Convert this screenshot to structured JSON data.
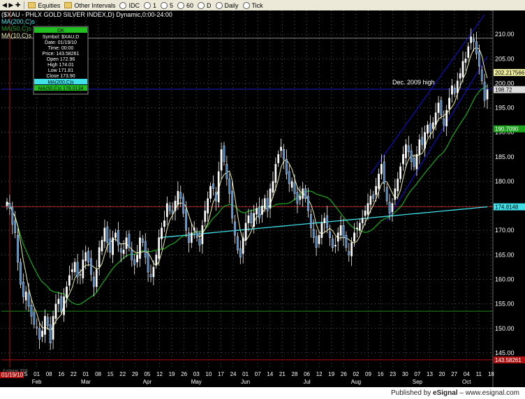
{
  "toolbar": {
    "items": [
      "Equities",
      "Other Intervals",
      "IDC",
      "1",
      "5",
      "60",
      "D",
      "Daily",
      "Tick"
    ]
  },
  "chart_data": {
    "type": "candlestick",
    "title": "($XAU - PHLX GOLD SILVER INDEX,D) Dynamic,0:00-24:00",
    "legend": {
      "ma_cyan": "MA(200,C)s",
      "ma_green": "MA(50,C)s",
      "ma_yellow": "MA(10,C)s"
    },
    "cursor_box": {
      "status": "OK",
      "rows": [
        "Symbol: $XAU,D",
        "Date: 01/19/10",
        "Time: 00:00",
        "Price: 143.58261",
        "Open 172.96",
        "High 174.01",
        "Low 171.81",
        "Close 173.90"
      ],
      "ma_row_cyan": "MA(200,C)s",
      "ma_row_green": "MA(50,C)s 178.0134"
    },
    "ylim": [
      142,
      214
    ],
    "y_ticks": [
      "145.00",
      "150.00",
      "155.00",
      "160.00",
      "165.00",
      "170.00",
      "175.00",
      "180.00",
      "185.00",
      "190.00",
      "195.00",
      "200.00",
      "205.00",
      "210.00"
    ],
    "x_ticks": [
      "25",
      "01",
      "08",
      "16",
      "22",
      "01",
      "08",
      "15",
      "22",
      "29",
      "05",
      "12",
      "19",
      "26",
      "03",
      "10",
      "17",
      "24",
      "01",
      "07",
      "14",
      "21",
      "28",
      "06",
      "12",
      "19",
      "26",
      "02",
      "09",
      "16",
      "23",
      "30",
      "07",
      "13",
      "20",
      "27",
      "04",
      "11",
      "18"
    ],
    "months": [
      "Feb",
      "Mar",
      "Apr",
      "May",
      "Jun",
      "Jul",
      "Aug",
      "Sep",
      "Oct"
    ],
    "cursor_date": "01/19/10",
    "annotation": "Dec. 2009 high",
    "price_tags": {
      "ma_yellow": "202.217566",
      "last": "198.72",
      "ma_green": "190.7090",
      "ma_cyan": "174.8148",
      "cursor": "143.58261"
    },
    "levels": {
      "dec_2009_high": 198.8,
      "red_horizontal": 174.8,
      "green_horizontal": 153.5,
      "top_horizontal": 209.2,
      "cursor": 143.58
    },
    "colors": {
      "up_candle": "#ffffff",
      "down_candle": "#3b7fc4",
      "ma10": "#f0f0a0",
      "ma50": "#1aa01a",
      "ma200": "#40e0e8",
      "channel": "#1010e0",
      "high_line": "#2020c0",
      "red_line": "#a02020"
    },
    "series_close": [
      175.8,
      174.5,
      171.2,
      169.5,
      163.5,
      159.0,
      156.5,
      157.5,
      154.5,
      152.5,
      150.8,
      150.0,
      147.8,
      149.5,
      152.5,
      150.5,
      147.0,
      152.5,
      155.0,
      156.0,
      153.5,
      156.5,
      158.5,
      160.8,
      162.0,
      163.5,
      160.5,
      161.0,
      164.0,
      165.5,
      163.5,
      161.0,
      158.5,
      162.0,
      166.5,
      168.0,
      170.5,
      167.5,
      165.5,
      168.5,
      169.5,
      167.0,
      165.5,
      166.0,
      168.5,
      166.5,
      164.0,
      163.0,
      165.0,
      168.5,
      167.5,
      164.5,
      161.5,
      160.5,
      162.5,
      165.0,
      168.5,
      170.5,
      172.0,
      175.5,
      174.0,
      173.5,
      176.0,
      178.0,
      176.5,
      173.5,
      170.0,
      167.5,
      169.5,
      170.5,
      168.5,
      167.0,
      171.0,
      174.0,
      176.5,
      179.0,
      178.5,
      176.0,
      182.0,
      186.5,
      184.0,
      180.5,
      177.5,
      172.5,
      169.0,
      166.0,
      164.5,
      168.5,
      171.5,
      173.0,
      171.5,
      173.5,
      174.5,
      172.5,
      175.0,
      176.5,
      174.0,
      178.5,
      180.0,
      183.5,
      185.5,
      187.0,
      184.5,
      181.5,
      179.5,
      180.0,
      177.5,
      175.5,
      177.0,
      178.5,
      176.5,
      174.0,
      170.5,
      168.5,
      166.5,
      169.0,
      171.5,
      172.5,
      170.5,
      168.5,
      166.5,
      167.0,
      169.5,
      171.0,
      168.5,
      166.5,
      165.0,
      167.5,
      169.5,
      170.5,
      171.5,
      172.5,
      174.0,
      175.5,
      177.0,
      176.5,
      179.0,
      181.5,
      183.5,
      179.5,
      176.0,
      173.5,
      175.5,
      178.5,
      180.5,
      183.0,
      185.5,
      187.5,
      186.0,
      184.0,
      183.0,
      185.5,
      188.5,
      187.5,
      190.0,
      191.5,
      190.0,
      192.0,
      194.0,
      196.0,
      193.5,
      191.5,
      194.5,
      197.0,
      199.5,
      198.0,
      200.5,
      202.0,
      204.5,
      205.0,
      207.5,
      209.5,
      208.5,
      206.0,
      203.5,
      200.5,
      196.5,
      198.7
    ],
    "ma10_start": 0,
    "ma50_start": 0,
    "ma200_start": 56
  }
}
